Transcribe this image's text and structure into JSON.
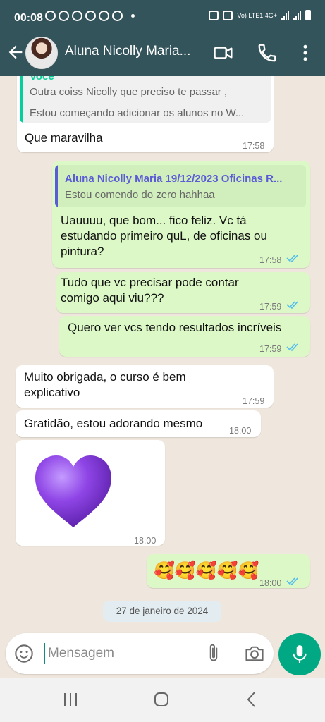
{
  "status_bar": {
    "time": "00:08",
    "indicators": "Vo) LTE1 4G+"
  },
  "header": {
    "contact_name": "Aluna Nicolly Maria...",
    "icons": [
      "back-arrow-icon",
      "video-call-icon",
      "phone-icon",
      "more-options-icon"
    ]
  },
  "messages": [
    {
      "dir": "in",
      "quote_title": "Você",
      "quote_text_1": "Outra coiss Nicolly que preciso te passar ,",
      "quote_text_2": "Estou começando adicionar os alunos no W...",
      "text": "Que maravilha",
      "time": "17:58"
    },
    {
      "dir": "out",
      "quote_title": "Aluna Nicolly Maria 19/12/2023 Oficinas R...",
      "quote_text": "Estou comendo do zero hahhaa",
      "text_lines": [
        "Uauuuu, que bom... fico feliz. Vc tá",
        "estudando primeiro quL, de oficinas ou",
        "pintura?"
      ],
      "time": "17:58"
    },
    {
      "dir": "out",
      "text_lines": [
        "Tudo que vc precisar pode contar",
        "comigo aqui viu???"
      ],
      "time": "17:59"
    },
    {
      "dir": "out",
      "text": "Quero ver vcs tendo resultados incríveis",
      "time": "17:59"
    },
    {
      "dir": "in",
      "text_lines": [
        "Muito obrigada, o curso é bem",
        "explicativo"
      ],
      "time": "17:59"
    },
    {
      "dir": "in",
      "text": "Gratidão, estou adorando mesmo",
      "time": "18:00"
    },
    {
      "dir": "in",
      "emoji": "💜",
      "time": "18:00"
    },
    {
      "dir": "out",
      "emoji": "🥰🥰🥰🥰🥰",
      "time": "18:00"
    }
  ],
  "date_chip": "27 de janeiro de 2024",
  "composer": {
    "placeholder": "Mensagem"
  },
  "colors": {
    "header": "#34545c",
    "outgoing": "#dcf8c6",
    "incoming": "#ffffff",
    "read_ticks": "#53bdeb",
    "accent": "#00a884"
  }
}
